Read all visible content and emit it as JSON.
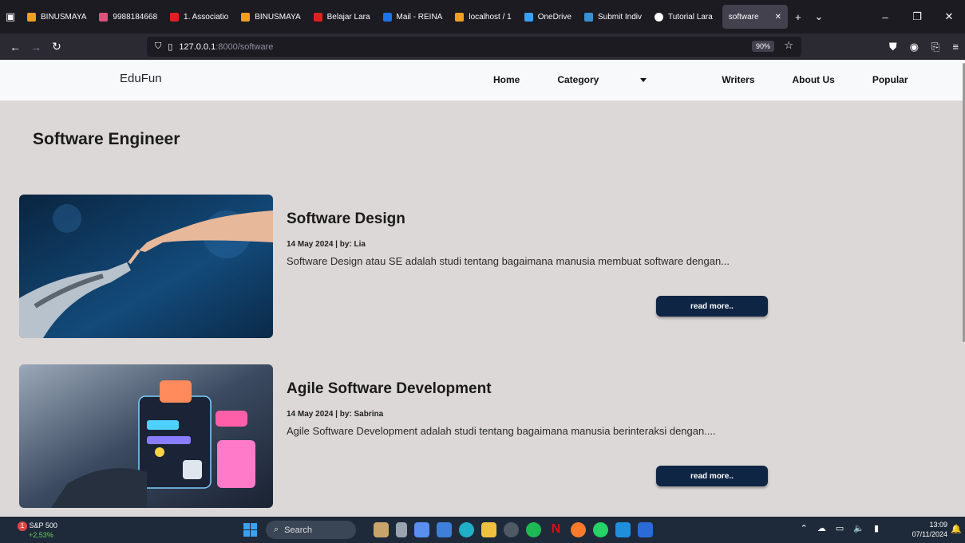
{
  "browser": {
    "tabs": [
      {
        "label": "BINUSMAYA",
        "color": "#f0a020"
      },
      {
        "label": "9988184668",
        "color": "#e0507a"
      },
      {
        "label": "1. Associatio",
        "color": "#e02020"
      },
      {
        "label": "BINUSMAYA",
        "color": "#f0a020"
      },
      {
        "label": "Belajar Lara",
        "color": "#e02020"
      },
      {
        "label": "Mail - REINA",
        "color": "#1a73e8"
      },
      {
        "label": "localhost / 1",
        "color": "#f0a020"
      },
      {
        "label": "OneDrive",
        "color": "#3aa0f0"
      },
      {
        "label": "Submit Indiv",
        "color": "#3a8fd0"
      },
      {
        "label": "Tutorial Lara",
        "color": "#ffffff"
      },
      {
        "label": "software",
        "color": "#42414d"
      }
    ],
    "url_host": "127.0.0.1",
    "url_path": ":8000/software",
    "zoom": "90%"
  },
  "site": {
    "brand": "EduFun",
    "nav": {
      "home": "Home",
      "category": "Category",
      "writers": "Writers",
      "about": "About Us",
      "popular": "Popular"
    },
    "page_title": "Software Engineer",
    "articles": [
      {
        "title": "Software Design",
        "meta": "14 May 2024 | by: Lia",
        "desc": "Software Design atau SE adalah studi tentang bagaimana manusia membuat software dengan...",
        "button": "read more.."
      },
      {
        "title": "Agile Software Development",
        "meta": "14 May 2024 | by: Sabrina",
        "desc": "Agile Software Development adalah studi tentang bagaimana manusia berinteraksi dengan....",
        "button": "read more.."
      }
    ]
  },
  "taskbar": {
    "stock_name": "S&P 500",
    "stock_change": "+2,53%",
    "stock_badge": "1",
    "search": "Search",
    "time": "13:09",
    "date": "07/11/2024"
  }
}
